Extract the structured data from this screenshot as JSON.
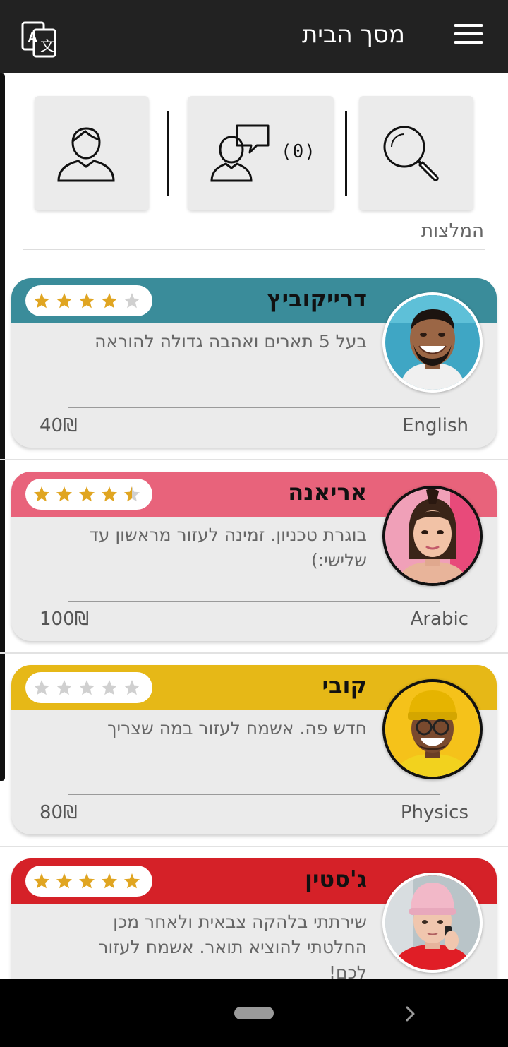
{
  "header": {
    "title": "מסך הבית",
    "translate_icon": "translate-icon",
    "menu_icon": "hamburger-menu-icon"
  },
  "quick_actions": {
    "search_icon": "magnifier-icon",
    "messages_icon": "chat-person-icon",
    "messages_count": "(0)",
    "profile_icon": "user-icon"
  },
  "section": {
    "title": "המלצות"
  },
  "colors": {
    "teal": "#3a8c9a",
    "pink": "#e8637b",
    "yellow": "#e6b817",
    "red": "#d52128",
    "star": "#e0a521",
    "star_empty": "#d0d0d0"
  },
  "tutors": [
    {
      "name": "דרייקוביץ",
      "description": "בעל 5 תארים ואהבה גדולה להוראה",
      "subject": "English",
      "price": "40₪",
      "rating": 4,
      "header_color": "#3a8c9a",
      "avatar": "tutor-photo"
    },
    {
      "name": "אריאנה",
      "description": "בוגרת טכניון. זמינה לעזור מראשון עד שלישי:)",
      "subject": "Arabic",
      "price": "100₪",
      "rating": 4.5,
      "header_color": "#e8637b",
      "avatar": "tutor-photo"
    },
    {
      "name": "קובי",
      "description": "חדש פה. אשמח לעזור במה שצריך",
      "subject": "Physics",
      "price": "80₪",
      "rating": 0,
      "header_color": "#e6b817",
      "avatar": "tutor-photo"
    },
    {
      "name": "ג'סטין",
      "description": "שירתתי בלהקה צבאית ולאחר מכן החלטתי להוציא תואר. אשמח לעזור לכם!",
      "subject": "",
      "price": "",
      "rating": 5,
      "header_color": "#d52128",
      "avatar": "tutor-photo"
    }
  ],
  "navbar": {
    "home_icon": "home-pill-icon",
    "next_icon": "chevron-right-icon"
  }
}
